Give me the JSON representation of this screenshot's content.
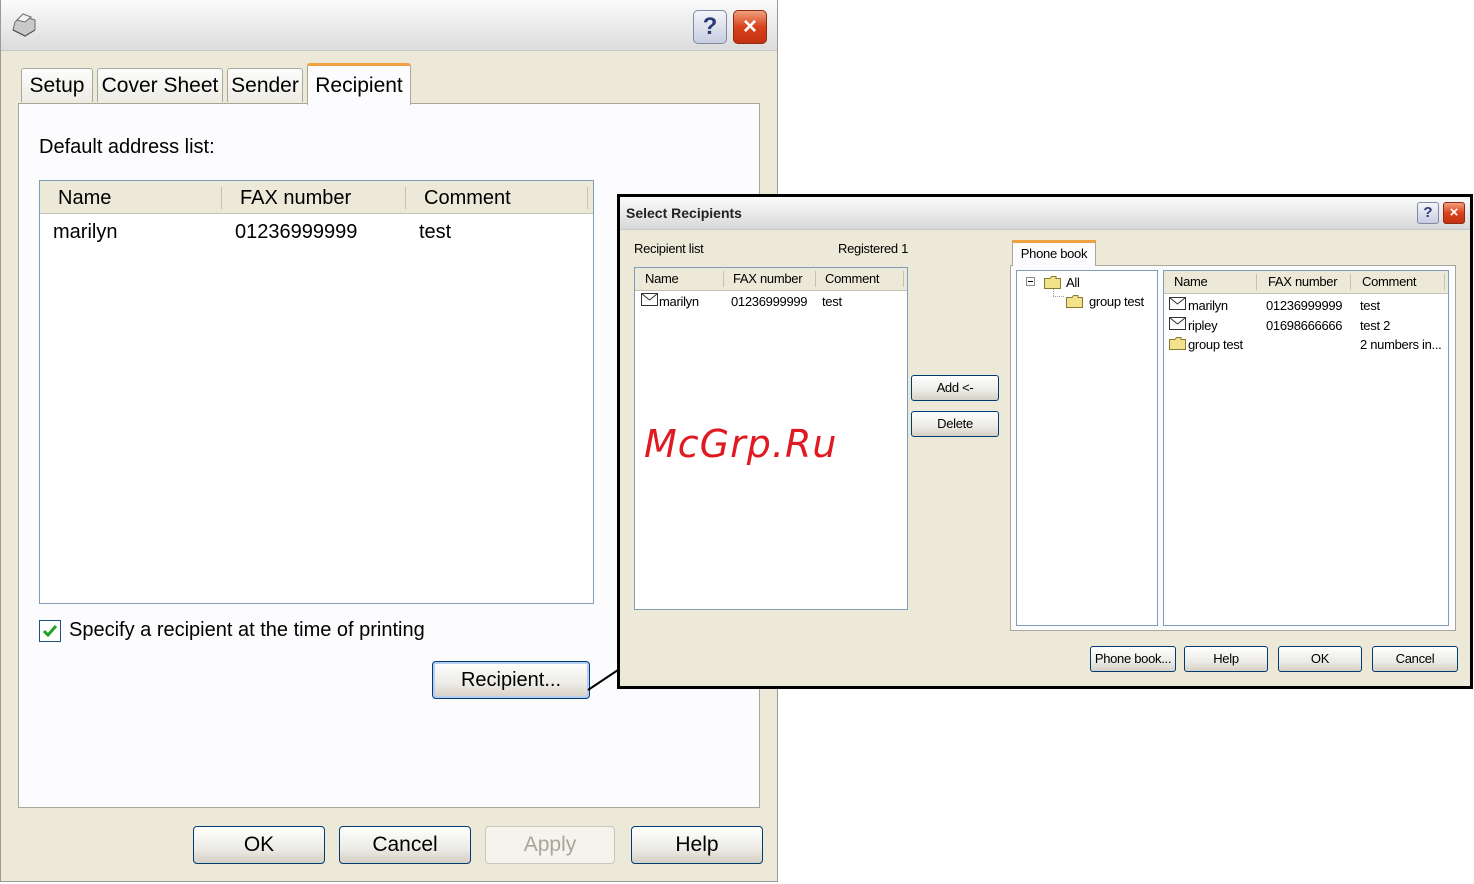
{
  "main_dialog": {
    "tabs": [
      "Setup",
      "Cover Sheet",
      "Sender",
      "Recipient"
    ],
    "active_tab": "Recipient",
    "default_address_label": "Default address list:",
    "address_list": {
      "columns": [
        "Name",
        "FAX number",
        "Comment"
      ],
      "rows": [
        {
          "name": "marilyn",
          "fax": "01236999999",
          "comment": "test"
        }
      ]
    },
    "specify_checkbox": {
      "label": "Specify a recipient at the time of printing",
      "checked": true
    },
    "recipient_button": "Recipient...",
    "buttons": {
      "ok": "OK",
      "cancel": "Cancel",
      "apply": "Apply",
      "help": "Help"
    },
    "title_buttons": {
      "help": "?",
      "close": "×"
    }
  },
  "select_dialog": {
    "title": "Select Recipients",
    "title_buttons": {
      "help": "?",
      "close": "×"
    },
    "recipient_list_label": "Recipient list",
    "registered_label": "Registered 1",
    "recipient_list": {
      "columns": [
        "Name",
        "FAX number",
        "Comment"
      ],
      "rows": [
        {
          "icon": "mail-icon",
          "name": "marilyn",
          "fax": "01236999999",
          "comment": "test"
        }
      ]
    },
    "add_button": "Add <-",
    "delete_button": "Delete",
    "phone_book_tab": "Phone book",
    "tree": {
      "root": "All",
      "children": [
        "group test"
      ]
    },
    "phone_book_list": {
      "columns": [
        "Name",
        "FAX number",
        "Comment"
      ],
      "rows": [
        {
          "icon": "mail-icon",
          "name": "marilyn",
          "fax": "01236999999",
          "comment": "test"
        },
        {
          "icon": "mail-icon",
          "name": "ripley",
          "fax": "01698666666",
          "comment": "test 2"
        },
        {
          "icon": "folder-icon",
          "name": "group test",
          "fax": "",
          "comment": "2 numbers in..."
        }
      ]
    },
    "buttons": {
      "phone_book": "Phone book...",
      "help": "Help",
      "ok": "OK",
      "cancel": "Cancel"
    }
  },
  "watermark": "McGrp.Ru",
  "colors": {
    "xp_button_border": "#003c74",
    "tab_highlight": "#f0a040",
    "close_button": "#d8421c",
    "watermark": "#e01a22"
  }
}
